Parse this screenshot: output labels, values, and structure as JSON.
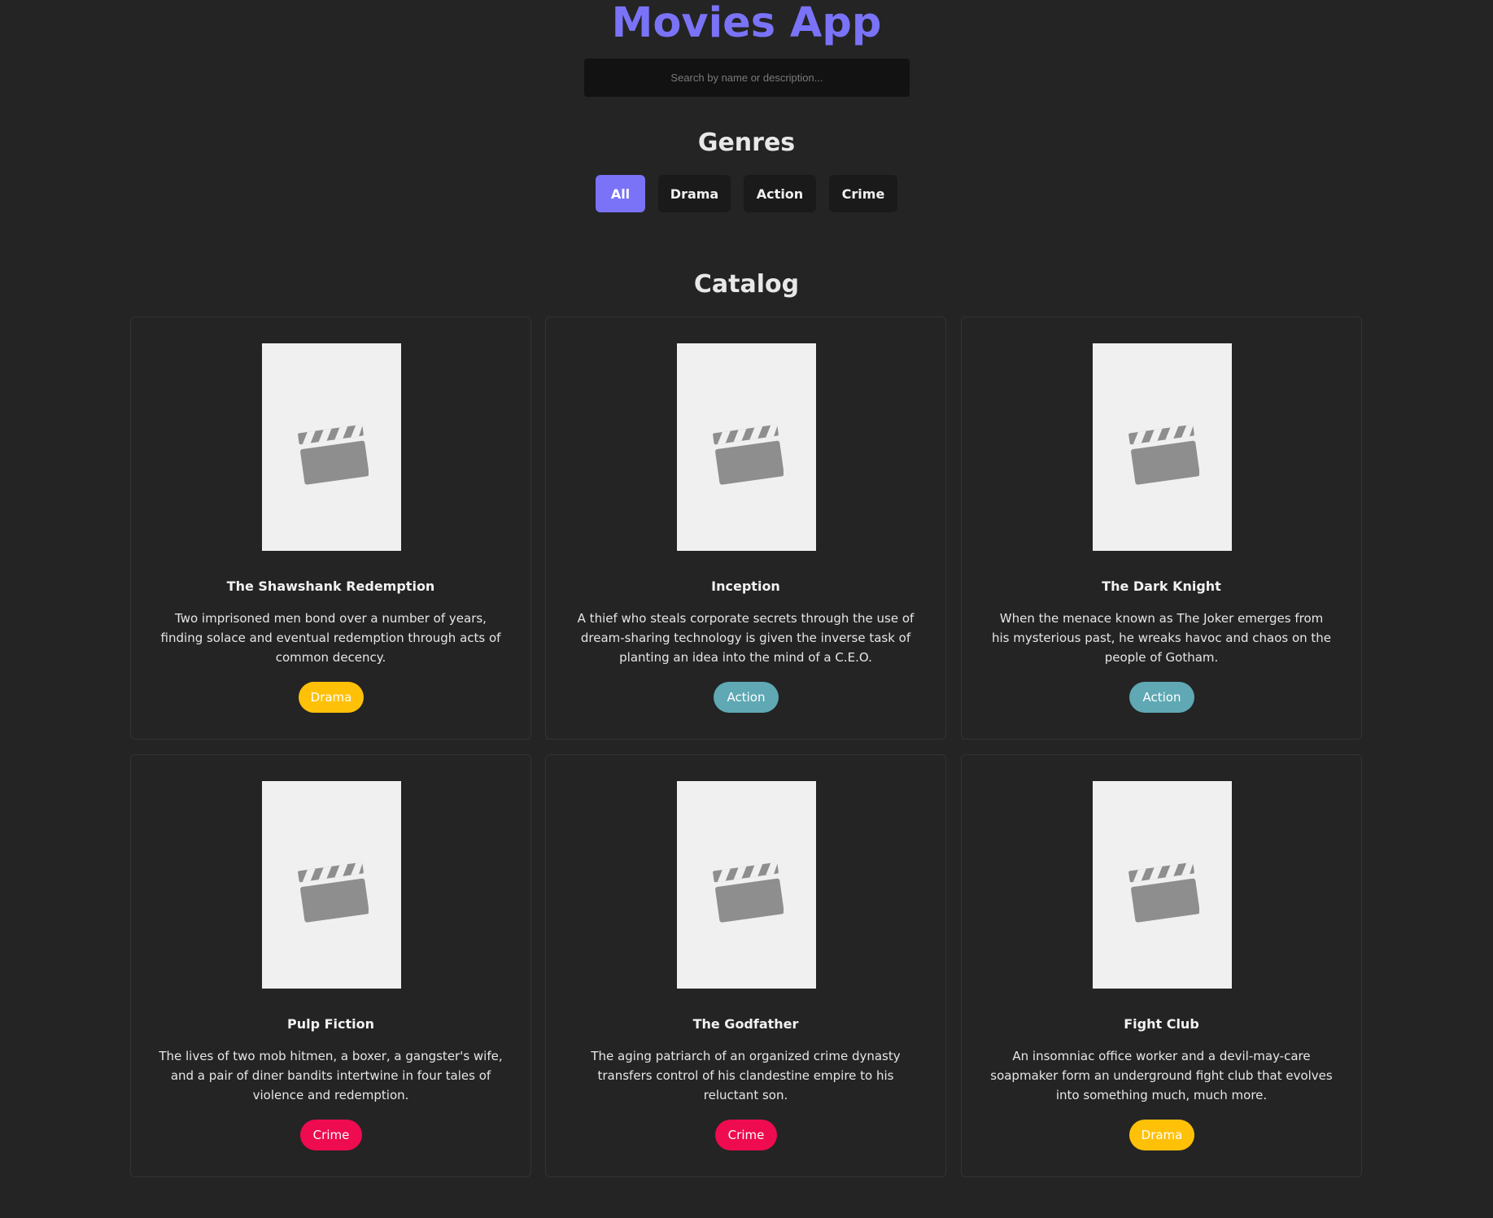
{
  "header": {
    "title": "Movies App"
  },
  "search": {
    "placeholder": "Search by name or description...",
    "value": ""
  },
  "genres": {
    "title": "Genres",
    "buttons": [
      {
        "label": "All",
        "active": true
      },
      {
        "label": "Drama",
        "active": false
      },
      {
        "label": "Action",
        "active": false
      },
      {
        "label": "Crime",
        "active": false
      }
    ]
  },
  "catalog": {
    "title": "Catalog",
    "movies": [
      {
        "title": "The Shawshank Redemption",
        "description": "Two imprisoned men bond over a number of years, finding solace and eventual redemption through acts of common decency.",
        "genre": "Drama",
        "poster_icon": "clapperboard-icon"
      },
      {
        "title": "Inception",
        "description": "A thief who steals corporate secrets through the use of dream-sharing technology is given the inverse task of planting an idea into the mind of a C.E.O.",
        "genre": "Action",
        "poster_icon": "clapperboard-icon"
      },
      {
        "title": "The Dark Knight",
        "description": "When the menace known as The Joker emerges from his mysterious past, he wreaks havoc and chaos on the people of Gotham.",
        "genre": "Action",
        "poster_icon": "clapperboard-icon"
      },
      {
        "title": "Pulp Fiction",
        "description": "The lives of two mob hitmen, a boxer, a gangster's wife, and a pair of diner bandits intertwine in four tales of violence and redemption.",
        "genre": "Crime",
        "poster_icon": "clapperboard-icon"
      },
      {
        "title": "The Godfather",
        "description": "The aging patriarch of an organized crime dynasty transfers control of his clandestine empire to his reluctant son.",
        "genre": "Crime",
        "poster_icon": "clapperboard-icon"
      },
      {
        "title": "Fight Club",
        "description": "An insomniac office worker and a devil-may-care soapmaker form an underground fight club that evolves into something much, much more.",
        "genre": "Drama",
        "poster_icon": "clapperboard-icon"
      }
    ]
  },
  "colors": {
    "background": "#242424",
    "accent": "#7a73f7",
    "drama": "#ffc107",
    "action": "#5fa8b4",
    "crime": "#ee0b4f"
  }
}
